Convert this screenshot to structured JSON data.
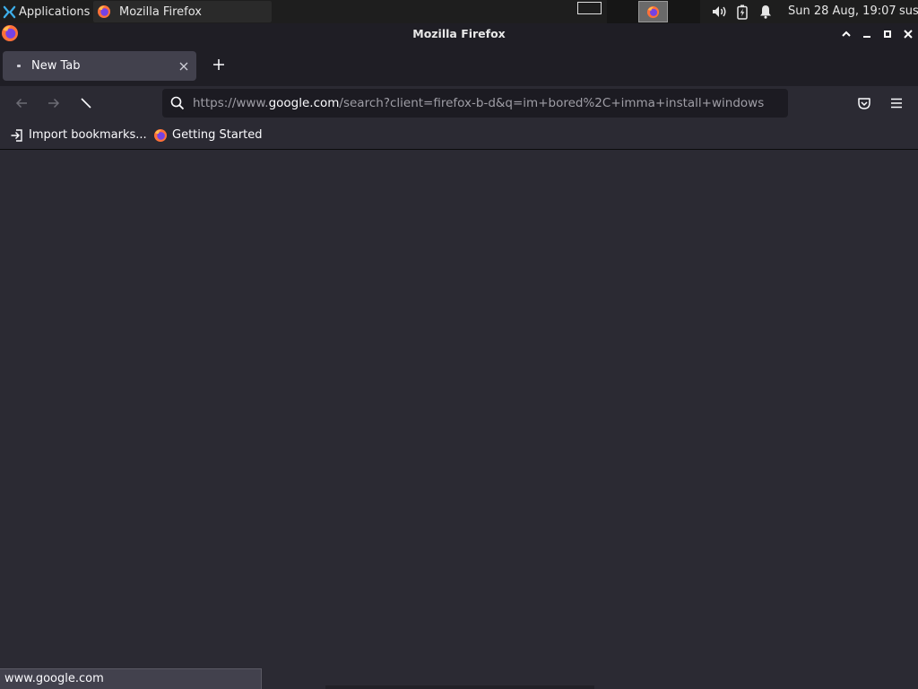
{
  "panel": {
    "applications_label": "Applications",
    "separator": "≡",
    "task_title": "Mozilla Firefox",
    "clock": "Sun 28 Aug, 19:07",
    "user": "sus"
  },
  "window": {
    "title": "Mozilla Firefox"
  },
  "tabs": [
    {
      "label": "New Tab"
    }
  ],
  "urlbar": {
    "prefix": "https://www.",
    "host": "google.com",
    "path": "/search?client=firefox-b-d&q=im+bored%2C+imma+install+windows"
  },
  "bookmarks": [
    {
      "label": "Import bookmarks...",
      "icon": "import-icon"
    },
    {
      "label": "Getting Started",
      "icon": "firefox-icon"
    }
  ],
  "status": {
    "text": "www.google.com"
  },
  "colors": {
    "chrome": "#1f1e25",
    "toolbar": "#2b2a33",
    "urlbar": "#1c1b22",
    "panel": "#1e1e1e"
  }
}
